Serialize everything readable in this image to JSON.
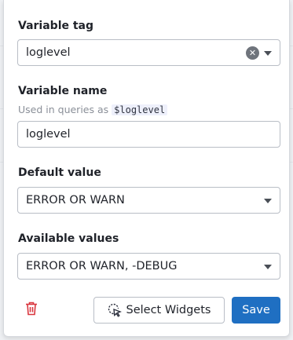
{
  "variable_tag": {
    "label": "Variable tag",
    "value": "loglevel"
  },
  "variable_name": {
    "label": "Variable name",
    "hint": "Used in queries as",
    "query_token": "$loglevel",
    "value": "loglevel"
  },
  "default_value": {
    "label": "Default value",
    "selected": "ERROR OR WARN"
  },
  "available_values": {
    "label": "Available values",
    "selected": "ERROR OR WARN, -DEBUG"
  },
  "actions": {
    "select_widgets_label": "Select Widgets",
    "save_label": "Save",
    "accent": "#1f6fc2",
    "danger": "#d9363e"
  }
}
